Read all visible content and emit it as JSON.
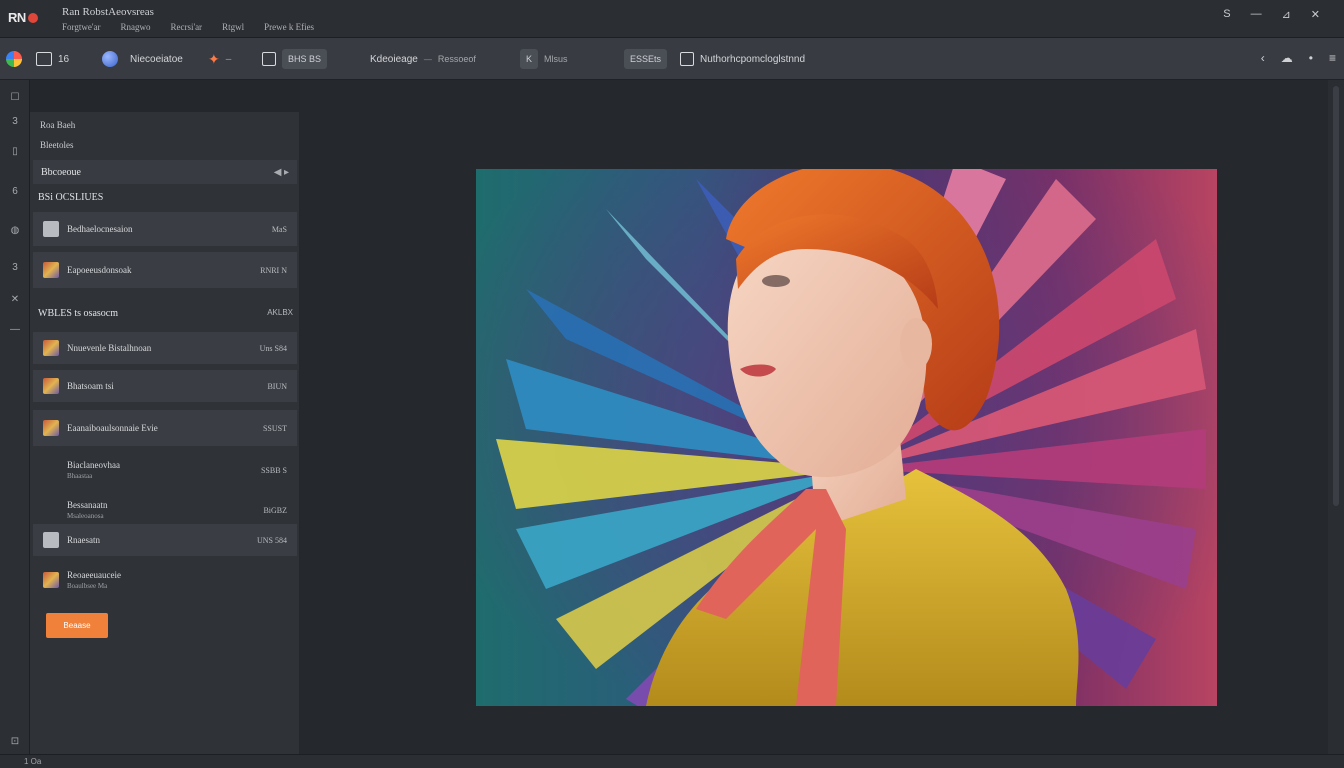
{
  "titlebar": {
    "logo_text": "RN",
    "app_title": "Ran RobstAeovsreas",
    "menus": [
      "Forgtwe'ar",
      "Rnagwo",
      "Recrsi'ar",
      "Rtgwl",
      "Prewe k Efies"
    ],
    "window_controls": [
      "S",
      "—",
      "⊿",
      "✕"
    ]
  },
  "toolbar": {
    "item_1": "16",
    "item_2_label": "Niecoeiatoe",
    "item_3": "BHS BS",
    "item_4": "Kdeoieage",
    "item_4_sub": "Ressoeof",
    "item_5": "K",
    "item_5_sub": "Mlsus",
    "item_6": "ESSEts",
    "item_7": "Nuthorhcpomcloglstnnd",
    "right_icons": [
      "‹",
      "☁",
      "•",
      "≡"
    ]
  },
  "rail": {
    "icons": [
      "☐",
      "3",
      "▯",
      "6",
      "◍",
      "3",
      "✕",
      "—",
      "⊡"
    ]
  },
  "panel": {
    "heading_1": "Roa Baeh",
    "heading_2": "Bleetoles",
    "section_title": "Bbcoeoue",
    "section_tools": "◀ ▸",
    "subsection_title": "BSi OCSLIUES",
    "rows_a": [
      {
        "label": "Bedhaelocnesaion",
        "value": "MaS",
        "dark": true,
        "thumb": "plain"
      },
      {
        "label": "Eapoeeusdonsoak",
        "value": "RNRI N",
        "dark": true,
        "thumb": "art"
      }
    ],
    "group_label": "WBLES ts osasocm",
    "group_value": "AKLBX",
    "rows_b": [
      {
        "label": "Nnuevenle Bistalhnoan",
        "value": "Uns S84",
        "dark": true,
        "thumb": "art"
      },
      {
        "label": "Bhatsoam tsi",
        "value": "BIUN",
        "dark": true,
        "thumb": "art"
      },
      {
        "label": "Eaanaiboaulsonnaie Evie",
        "value": "SSUST",
        "dark": true,
        "thumb": "art"
      },
      {
        "label": "Biaclaneovhaa",
        "sub": "Bhaastaa",
        "value": "SSBB S",
        "dark": false,
        "thumb": "none"
      },
      {
        "label": "Bessanaatn",
        "sub": "Msaleoanosa",
        "value": "BiGBZ",
        "dark": false,
        "thumb": "none"
      },
      {
        "label": "Rnaesatn",
        "value": "UNS 584",
        "dark": true,
        "thumb": "plain"
      },
      {
        "label": "Reoaeeuauceie",
        "sub": "Boaulbsee Ma",
        "value": "",
        "dark": false,
        "thumb": "art"
      }
    ],
    "action_button": "Beaase"
  },
  "status": {
    "text": "1 Oa"
  }
}
